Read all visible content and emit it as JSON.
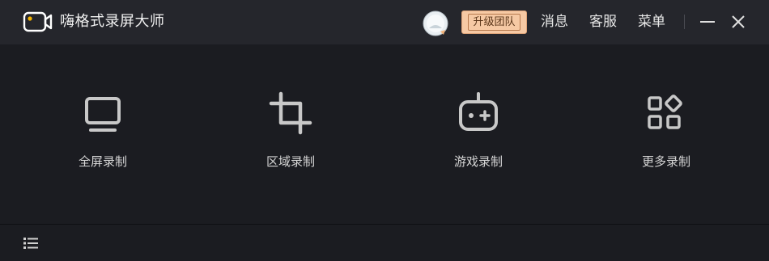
{
  "app": {
    "title": "嗨格式录屏大师",
    "logo_icon": "camera-icon"
  },
  "header": {
    "avatar_icon": "user-avatar-icon",
    "upgrade_label": "升级团队",
    "nav": [
      {
        "label": "消息"
      },
      {
        "label": "客服"
      },
      {
        "label": "菜单"
      }
    ],
    "minimize_icon": "minimize-icon",
    "close_icon": "close-icon"
  },
  "modes": [
    {
      "label": "全屏录制",
      "icon": "monitor-icon"
    },
    {
      "label": "区域录制",
      "icon": "crop-icon"
    },
    {
      "label": "游戏录制",
      "icon": "gamepad-icon"
    },
    {
      "label": "更多录制",
      "icon": "apps-icon"
    }
  ],
  "footer": {
    "list_icon": "list-icon"
  },
  "colors": {
    "background": "#1b1c21",
    "titlebar": "#25262c",
    "upgrade_bg": "#f6c9a4",
    "icon": "#c8c8c8"
  }
}
